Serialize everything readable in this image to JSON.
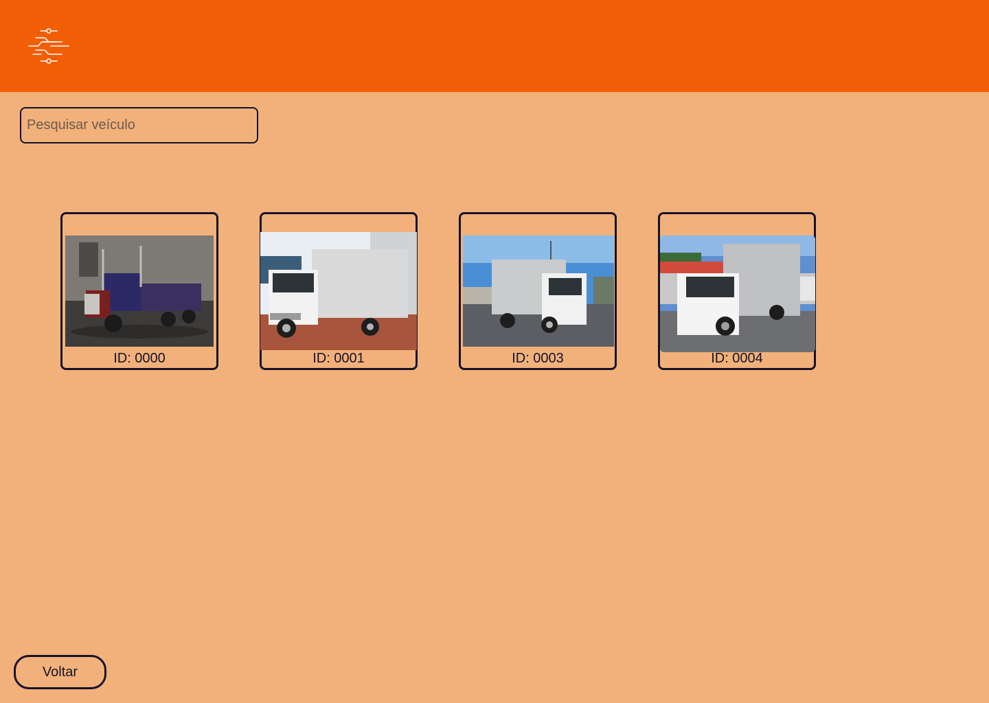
{
  "header": {
    "brand_color": "#f25e06",
    "logo_icon": "circuit-logo-icon"
  },
  "search": {
    "placeholder": "Pesquisar veículo",
    "value": ""
  },
  "vehicles": [
    {
      "id_label": "ID: 0000",
      "photo": "red-semi-truck-photo"
    },
    {
      "id_label": "ID: 0001",
      "photo": "white-box-truck-photo"
    },
    {
      "id_label": "ID: 0003",
      "photo": "white-box-truck-photo"
    },
    {
      "id_label": "ID: 0004",
      "photo": "white-light-box-truck-photo"
    }
  ],
  "footer": {
    "back_label": "Voltar"
  },
  "colors": {
    "page_background": "#f2b17a",
    "border": "#14122b"
  }
}
